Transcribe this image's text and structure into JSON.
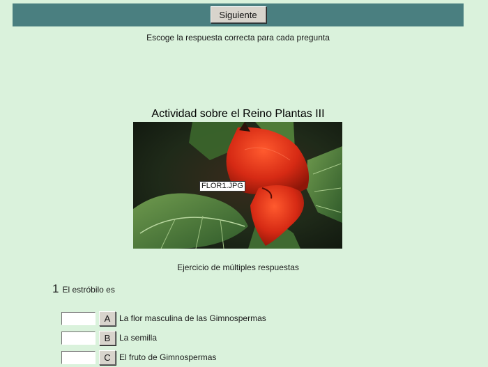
{
  "toolbar": {
    "next_label": "Siguiente"
  },
  "instructions": "Escoge la respuesta correcta para cada pregunta",
  "title": "Actividad sobre el Reino Plantas III",
  "image": {
    "label": "FLOR1.JPG"
  },
  "subtitle": "Ejercicio de múltiples respuestas",
  "question": {
    "number": "1",
    "text": "El estróbilo es",
    "answers": [
      {
        "letter": "A",
        "text": "La flor masculina de las Gimnospermas",
        "value": ""
      },
      {
        "letter": "B",
        "text": "La semilla",
        "value": ""
      },
      {
        "letter": "C",
        "text": "El fruto de Gimnospermas",
        "value": ""
      }
    ]
  },
  "colors": {
    "background": "#daf2dc",
    "toolbar": "#4a7f80"
  }
}
